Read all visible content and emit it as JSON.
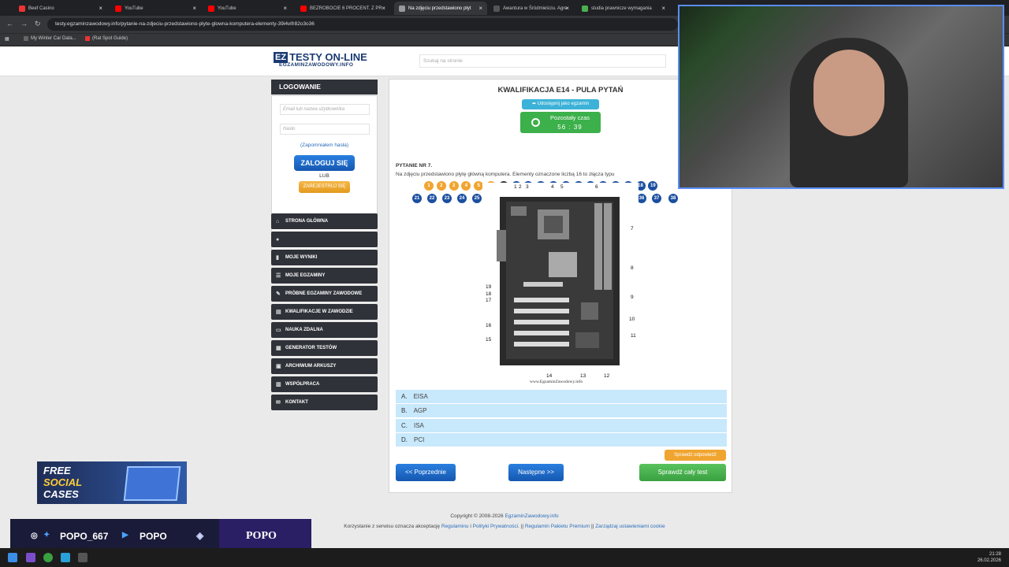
{
  "browser": {
    "tabs": [
      {
        "label": "Beef Casino",
        "color": "#e33"
      },
      {
        "label": "YouTube",
        "color": "#f00"
      },
      {
        "label": "YouTube",
        "color": "#f00"
      },
      {
        "label": "BEZROBOCIE 6 PROCENT. Z PR",
        "color": "#f00"
      },
      {
        "label": "Na zdjęciu przedstawiono płyt",
        "color": "#999"
      },
      {
        "label": "Awantura w Śródmieściu. Agre",
        "color": "#555"
      },
      {
        "label": "studia prawnicze wymagania",
        "color": "#4caf50"
      }
    ],
    "url": "testy.egzaminzawodowy.info/pytanie-na-zdjeciu-przedstawiono-plyte-glowna-komputera-elementy-39i4vifr82o3o36",
    "bookmarks": [
      "My Winter Car Data...",
      "(Rat Spot Guide)"
    ]
  },
  "site": {
    "logo_ez": "EZ",
    "logo_title": "TESTY ON-LINE",
    "logo_sub": "EGZAMINZAWODOWY.INFO",
    "search_placeholder": "Szukaj na stronie"
  },
  "login": {
    "header": "LOGOWANIE",
    "email_placeholder": "Email lub nazwa użytkownika",
    "password_placeholder": "Hasło",
    "forgot": "(Zapomniałem hasła)",
    "login_button": "ZALOGUJ SIĘ",
    "or": "LUB",
    "register_button": "ZAREJESTRUJ SIĘ"
  },
  "menu": [
    {
      "label": "STRONA GŁÓWNA",
      "icon": "home-icon",
      "glyph": "⌂"
    },
    {
      "label": "",
      "icon": "user-icon",
      "glyph": "●",
      "red": true
    },
    {
      "label": "MOJE WYNIKI",
      "icon": "chart-icon",
      "glyph": "▮"
    },
    {
      "label": "MOJE EGZAMINY",
      "icon": "list-icon",
      "glyph": "☰"
    },
    {
      "label": "PRÓBNE EGZAMINY ZAWODOWE",
      "icon": "pencil-icon",
      "glyph": "✎"
    },
    {
      "label": "KWALIFIKACJE W ZAWODZIE",
      "icon": "book-icon",
      "glyph": "▤"
    },
    {
      "label": "NAUKA ZDALNA",
      "icon": "laptop-icon",
      "glyph": "▭"
    },
    {
      "label": "GENERATOR TESTÓW",
      "icon": "gear-icon",
      "glyph": "▦"
    },
    {
      "label": "ARCHIWUM ARKUSZY",
      "icon": "archive-icon",
      "glyph": "▣"
    },
    {
      "label": "WSPÓŁPRACA",
      "icon": "handshake-icon",
      "glyph": "▥"
    },
    {
      "label": "KONTAKT",
      "icon": "mail-icon",
      "glyph": "✉"
    }
  ],
  "quiz": {
    "title": "KWALIFIKACJA E14 - PULA PYTAŃ",
    "share": "Udostępnij jako egzamin",
    "timer_label": "Pozostały czas",
    "timer_value": "56 : 39",
    "row1": [
      "1",
      "2",
      "3",
      "4",
      "5",
      "6",
      "7",
      "8",
      "9",
      "10",
      "11",
      "12",
      "13",
      "14",
      "15",
      "16",
      "17",
      "18",
      "19"
    ],
    "row2": [
      "21",
      "22",
      "23",
      "24",
      "25",
      "26",
      "27",
      "28",
      "29",
      "30",
      "31",
      "32",
      "33",
      "34",
      "35",
      "36",
      "37",
      "38"
    ],
    "question_label": "PYTANIE NR 7.",
    "question_text": "Na zdjęciu przedstawiono płytę główną komputera. Elementy oznaczone liczbą 16 to złącza typu",
    "image_caption": "www.EgzaminZawodowy.info",
    "image_labels": [
      "1",
      "2",
      "3",
      "4",
      "5",
      "6",
      "7",
      "8",
      "9",
      "10",
      "11",
      "12",
      "13",
      "14",
      "15",
      "16",
      "17",
      "18",
      "19"
    ],
    "answers": [
      {
        "letter": "A.",
        "text": "EISA"
      },
      {
        "letter": "B.",
        "text": "AGP"
      },
      {
        "letter": "C.",
        "text": "ISA"
      },
      {
        "letter": "D.",
        "text": "PCI"
      }
    ],
    "check_answer": "Sprawdź odpowiedź",
    "prev": "<< Poprzednie",
    "next": "Następne >>",
    "check_all": "Sprawdź cały test"
  },
  "footer": {
    "copyright": "Copyright © 2008-2026 ",
    "copyright_link": "EgzaminZawodowy.info",
    "terms_prefix": "Korzystanie z serwisu oznacza akceptację ",
    "regulamin": "Regulaminu",
    "and": " i ",
    "polityka": "Polityki Prywatności.",
    "sep": " || ",
    "premium": "Regulamin Pakietu Premium",
    "cookies": "Zarządzaj ustawieniami cookie"
  },
  "overlay": {
    "promo_l1": "FREE",
    "promo_l2": "SOCIAL",
    "promo_l3": "CASES",
    "handle1": "POPO_667",
    "handle2": "POPO",
    "brand": "POPO"
  },
  "taskbar": {
    "time": "21:28",
    "date": "26.02.2026"
  }
}
